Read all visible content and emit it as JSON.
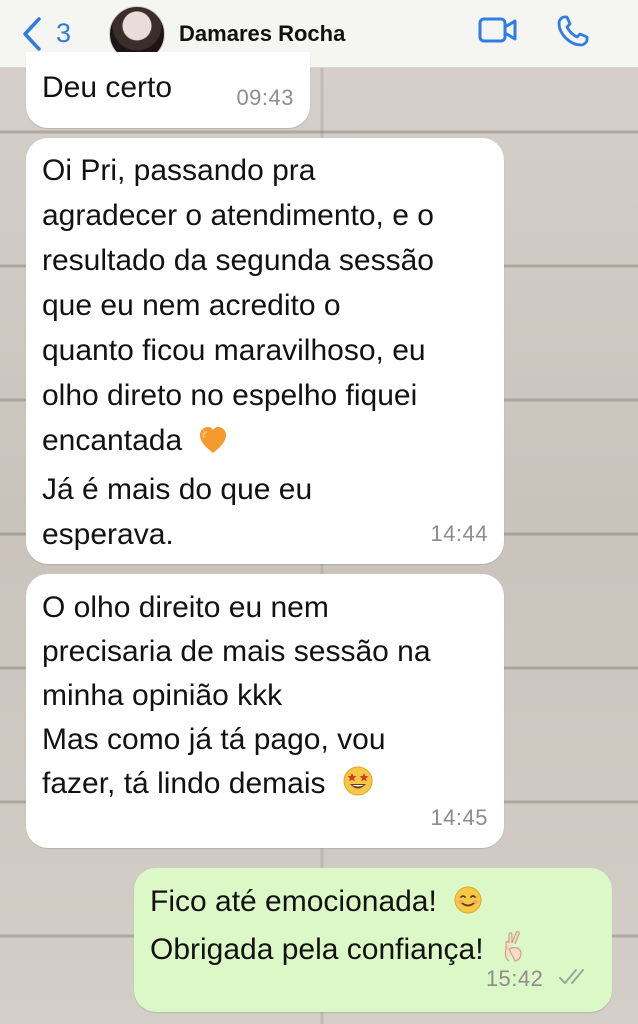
{
  "header": {
    "back_count": "3",
    "contact_name": "Damares Rocha",
    "icons": [
      "chevron-left-icon",
      "video-call-icon",
      "phone-call-icon"
    ]
  },
  "messages": [
    {
      "direction": "incoming",
      "text": "Deu certo",
      "time": "09:43"
    },
    {
      "direction": "incoming",
      "lines": [
        "Oi Pri, passando pra",
        "agradecer o atendimento, e o",
        "resultado da segunda sessão",
        "que eu nem acredito o",
        "quanto ficou maravilhoso, eu",
        "olho direto no espelho fiquei",
        "encantada",
        "Já é mais do que eu",
        "esperava."
      ],
      "emoji": "orange-heart",
      "time": "14:44"
    },
    {
      "direction": "incoming",
      "lines": [
        "O olho direito eu nem",
        "precisaria de mais sessão na",
        "minha opinião kkk",
        "Mas como já tá pago, vou",
        "fazer, tá lindo demais"
      ],
      "emoji": "star-struck",
      "time": "14:45"
    },
    {
      "direction": "outgoing",
      "lines": [
        "Fico até emocionada!",
        "Obrigada pela confiança!"
      ],
      "emojis": [
        "smiling-face",
        "crossed-fingers"
      ],
      "time": "15:42",
      "status": "read"
    }
  ],
  "colors": {
    "accent": "#2f7de1",
    "incoming_bubble": "#ffffff",
    "outgoing_bubble": "#dcf8c6",
    "timestamp": "#8d8d8d"
  }
}
